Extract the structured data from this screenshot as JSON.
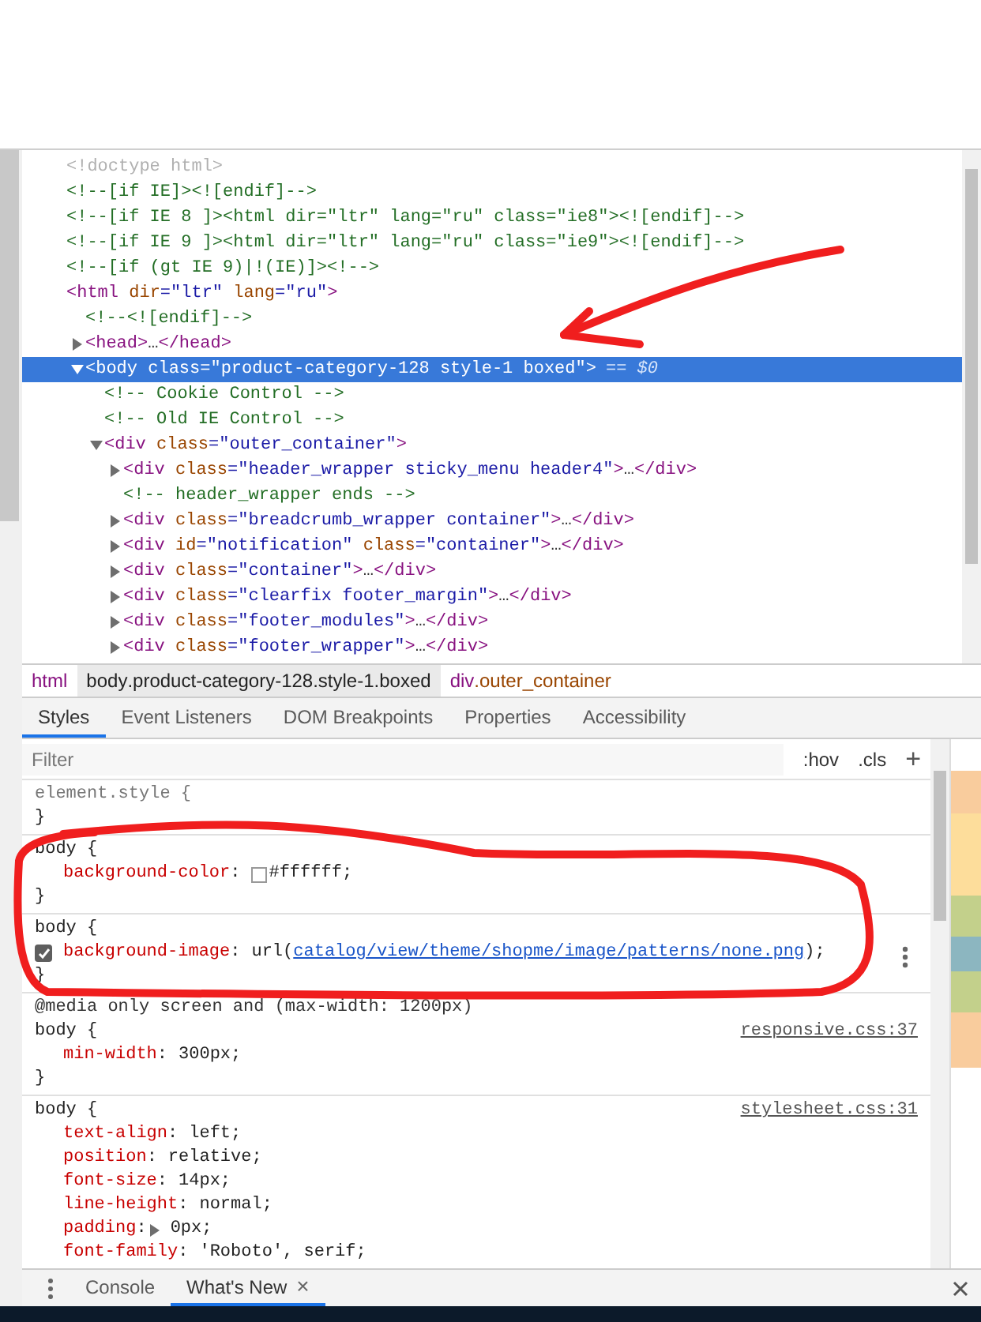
{
  "dom_tree": [
    {
      "segments": [
        {
          "text": "<!doctype html>",
          "kind": "doctype"
        }
      ]
    },
    {
      "segments": [
        {
          "text": "<!--[if IE]><![endif]-->",
          "kind": "comment"
        }
      ]
    },
    {
      "segments": [
        {
          "text": "<!--[if IE 8 ]><html dir=\"ltr\" lang=\"ru\" class=\"ie8\"><![endif]-->",
          "kind": "comment"
        }
      ]
    },
    {
      "segments": [
        {
          "text": "<!--[if IE 9 ]><html dir=\"ltr\" lang=\"ru\" class=\"ie9\"><![endif]-->",
          "kind": "comment"
        }
      ]
    },
    {
      "segments": [
        {
          "text": "<!--[if (gt IE 9)|!(IE)]><!-->",
          "kind": "comment"
        }
      ]
    },
    {
      "segments": [
        {
          "text": "<html",
          "kind": "tag"
        },
        {
          "text": " dir",
          "kind": "attr"
        },
        {
          "text": "=\"ltr\"",
          "kind": "value"
        },
        {
          "text": " lang",
          "kind": "attr"
        },
        {
          "text": "=\"ru\"",
          "kind": "value"
        },
        {
          "text": ">",
          "kind": "tag"
        }
      ],
      "children": [
        {
          "segments": [
            {
              "text": "<!--<![endif]-->",
              "kind": "comment"
            }
          ]
        },
        {
          "expanded": false,
          "selected": false,
          "segments": [
            {
              "text": "<head>",
              "kind": "tag"
            },
            {
              "text": "…",
              "kind": "plain"
            },
            {
              "text": "</head>",
              "kind": "tag"
            }
          ]
        },
        {
          "expanded": true,
          "selected": true,
          "segments": [
            {
              "text": "<body"
            },
            {
              "text": " class"
            },
            {
              "text": "=\"product-category-128 style-1 boxed\""
            },
            {
              "text": ">"
            }
          ],
          "suffix": "== $0",
          "children": [
            {
              "segments": [
                {
                  "text": "<!-- Cookie Control -->",
                  "kind": "comment"
                }
              ]
            },
            {
              "segments": [
                {
                  "text": "<!-- Old IE Control -->",
                  "kind": "comment"
                }
              ]
            },
            {
              "expanded": true,
              "selected": false,
              "segments": [
                {
                  "text": "<div",
                  "kind": "tag"
                },
                {
                  "text": " class",
                  "kind": "attr"
                },
                {
                  "text": "=\"outer_container\"",
                  "kind": "value"
                },
                {
                  "text": ">",
                  "kind": "tag"
                }
              ],
              "children": [
                {
                  "expanded": false,
                  "selected": false,
                  "segments": [
                    {
                      "text": "<div",
                      "kind": "tag"
                    },
                    {
                      "text": " class",
                      "kind": "attr"
                    },
                    {
                      "text": "=\"header_wrapper sticky_menu header4\"",
                      "kind": "value"
                    },
                    {
                      "text": ">",
                      "kind": "tag"
                    },
                    {
                      "text": "…",
                      "kind": "plain"
                    },
                    {
                      "text": "</div>",
                      "kind": "tag"
                    }
                  ]
                },
                {
                  "segments": [
                    {
                      "text": "<!-- header_wrapper ends -->",
                      "kind": "comment"
                    }
                  ]
                },
                {
                  "expanded": false,
                  "selected": false,
                  "segments": [
                    {
                      "text": "<div",
                      "kind": "tag"
                    },
                    {
                      "text": " class",
                      "kind": "attr"
                    },
                    {
                      "text": "=\"breadcrumb_wrapper container\"",
                      "kind": "value"
                    },
                    {
                      "text": ">",
                      "kind": "tag"
                    },
                    {
                      "text": "…",
                      "kind": "plain"
                    },
                    {
                      "text": "</div>",
                      "kind": "tag"
                    }
                  ]
                },
                {
                  "expanded": false,
                  "selected": false,
                  "segments": [
                    {
                      "text": "<div",
                      "kind": "tag"
                    },
                    {
                      "text": " id",
                      "kind": "attr"
                    },
                    {
                      "text": "=\"notification\"",
                      "kind": "value"
                    },
                    {
                      "text": " class",
                      "kind": "attr"
                    },
                    {
                      "text": "=\"container\"",
                      "kind": "value"
                    },
                    {
                      "text": ">",
                      "kind": "tag"
                    },
                    {
                      "text": "…",
                      "kind": "plain"
                    },
                    {
                      "text": "</div>",
                      "kind": "tag"
                    }
                  ]
                },
                {
                  "expanded": false,
                  "selected": false,
                  "segments": [
                    {
                      "text": "<div",
                      "kind": "tag"
                    },
                    {
                      "text": " class",
                      "kind": "attr"
                    },
                    {
                      "text": "=\"container\"",
                      "kind": "value"
                    },
                    {
                      "text": ">",
                      "kind": "tag"
                    },
                    {
                      "text": "…",
                      "kind": "plain"
                    },
                    {
                      "text": "</div>",
                      "kind": "tag"
                    }
                  ]
                },
                {
                  "expanded": false,
                  "selected": false,
                  "segments": [
                    {
                      "text": "<div",
                      "kind": "tag"
                    },
                    {
                      "text": " class",
                      "kind": "attr"
                    },
                    {
                      "text": "=\"clearfix footer_margin\"",
                      "kind": "value"
                    },
                    {
                      "text": ">",
                      "kind": "tag"
                    },
                    {
                      "text": "…",
                      "kind": "plain"
                    },
                    {
                      "text": "</div>",
                      "kind": "tag"
                    }
                  ]
                },
                {
                  "expanded": false,
                  "selected": false,
                  "segments": [
                    {
                      "text": "<div",
                      "kind": "tag"
                    },
                    {
                      "text": " class",
                      "kind": "attr"
                    },
                    {
                      "text": "=\"footer_modules\"",
                      "kind": "value"
                    },
                    {
                      "text": ">",
                      "kind": "tag"
                    },
                    {
                      "text": "…",
                      "kind": "plain"
                    },
                    {
                      "text": "</div>",
                      "kind": "tag"
                    }
                  ]
                },
                {
                  "expanded": false,
                  "selected": false,
                  "segments": [
                    {
                      "text": "<div",
                      "kind": "tag"
                    },
                    {
                      "text": " class",
                      "kind": "attr"
                    },
                    {
                      "text": "=\"footer_wrapper\"",
                      "kind": "value"
                    },
                    {
                      "text": ">",
                      "kind": "tag"
                    },
                    {
                      "text": "…",
                      "kind": "plain"
                    },
                    {
                      "text": "</div>",
                      "kind": "tag"
                    }
                  ]
                }
              ]
            }
          ]
        }
      ]
    }
  ],
  "breadcrumbs": [
    {
      "tag": "html",
      "selected": false
    },
    {
      "tag": "body",
      "rest": ".product-category-128.style-1.boxed",
      "selected": true
    },
    {
      "tag": "div",
      "rest": ".outer_container",
      "selected": false
    }
  ],
  "tabs": [
    {
      "label": "Styles",
      "selected": true
    },
    {
      "label": "Event Listeners",
      "selected": false
    },
    {
      "label": "DOM Breakpoints",
      "selected": false
    },
    {
      "label": "Properties",
      "selected": false
    },
    {
      "label": "Accessibility",
      "selected": false
    }
  ],
  "filter": {
    "placeholder": "Filter",
    "hov": ":hov",
    "cls": ".cls",
    "add": "+"
  },
  "rules": [
    {
      "selector": "element.style {",
      "dim": true,
      "close": "}"
    },
    {
      "selector": "body {",
      "dim": false,
      "close": "}",
      "declarations": [
        {
          "property": "background-color",
          "sep": ":",
          "swatch": true,
          "value": "#ffffff;"
        }
      ]
    },
    {
      "selector": "body {",
      "dim": false,
      "close": "}",
      "menu": true,
      "declarations": [
        {
          "property": "background-image",
          "sep": ":",
          "checked": true,
          "value": "url(",
          "link": "catalog/view/theme/shopme/image/patterns/none.png",
          "after": ");"
        }
      ]
    },
    {
      "media": "@media only screen and (max-width: 1200px)",
      "selector": "body {",
      "dim": false,
      "source": "responsive.css:37",
      "close": "}",
      "declarations": [
        {
          "property": "min-width",
          "sep": ":",
          "value": "300px;"
        }
      ]
    },
    {
      "selector": "body {",
      "dim": false,
      "source": "stylesheet.css:31",
      "declarations": [
        {
          "property": "text-align",
          "sep": ":",
          "value": "left;"
        },
        {
          "property": "position",
          "sep": ":",
          "value": "relative;"
        },
        {
          "property": "font-size",
          "sep": ":",
          "value": "14px;"
        },
        {
          "property": "line-height",
          "sep": ":",
          "value": "normal;"
        },
        {
          "property": "padding",
          "sep": ":",
          "expander": true,
          "value": "0px;"
        },
        {
          "property": "font-family",
          "sep": ":",
          "value": "'Roboto', serif;"
        }
      ]
    }
  ],
  "drawer_tabs": [
    {
      "label": "Console",
      "selected": false,
      "closable": false
    },
    {
      "label": "What's New",
      "selected": true,
      "closable": true,
      "close": "×"
    }
  ]
}
